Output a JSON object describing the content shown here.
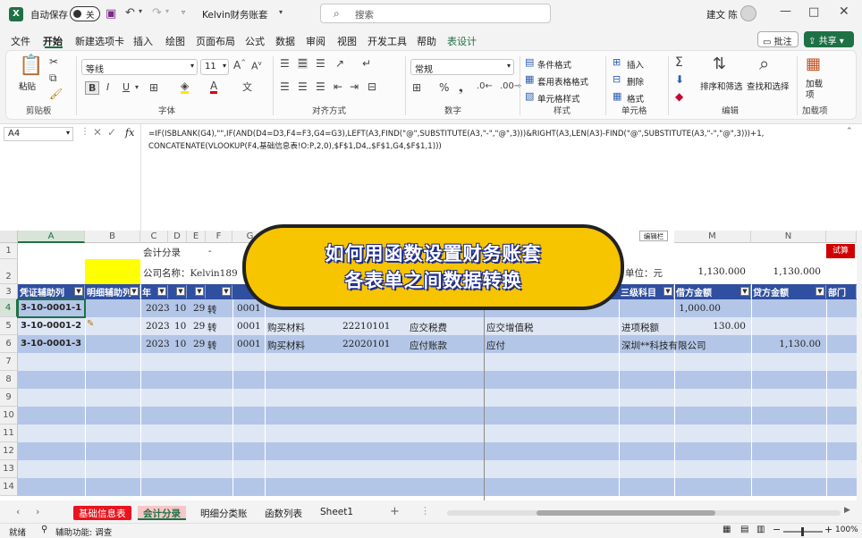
{
  "titlebar": {
    "autosave_label": "自动保存",
    "autosave_state": "关",
    "filename": "Kelvin财务账套",
    "search_placeholder": "搜索",
    "user": "建文 陈"
  },
  "menu": [
    "文件",
    "开始",
    "新建选项卡",
    "插入",
    "绘图",
    "页面布局",
    "公式",
    "数据",
    "审阅",
    "视图",
    "开发工具",
    "帮助",
    "表设计"
  ],
  "menu_active": "开始",
  "comments_button": "批注",
  "share_button": "共享",
  "ribbon": {
    "paste": "粘贴",
    "clipboard": "剪贴板",
    "font_name": "等线",
    "font_size": "11",
    "font_group": "字体",
    "align_group": "对齐方式",
    "number_format": "常规",
    "number_group": "数字",
    "cond_format": "条件格式",
    "table_format": "套用表格格式",
    "cell_style": "单元格样式",
    "style_group": "样式",
    "insert": "插入",
    "delete": "删除",
    "format": "格式",
    "cells_group": "单元格",
    "sort_filter": "排序和筛选",
    "find_select": "查找和选择",
    "edit_group": "编辑",
    "addin": "加载项",
    "addin_group": "加载项"
  },
  "formula_bar": {
    "name_box": "A4",
    "fx": "fx",
    "formula_line1": "=IF(ISBLANK(G4),\"\",IF(AND(D4=D3,F4=F3,G4=G3),LEFT(A3,FIND(\"@\",SUBSTITUTE(A3,\"-\",\"@\",3)))&RIGHT(A3,LEN(A3)-FIND(\"@\",SUBSTITUTE(A3,\"-\",\"@\",3)))+1,",
    "formula_line2": "CONCATENATE(VLOOKUP(F4,基础信息表!O:P,2,0),$F$1,D4,,$F$1,G4,$F$1,1)))"
  },
  "grid": {
    "columns": [
      "A",
      "B",
      "C",
      "D",
      "E",
      "F",
      "G",
      "M",
      "N"
    ],
    "row_numbers": [
      "1",
      "2",
      "3",
      "4",
      "5",
      "6",
      "7",
      "8",
      "9",
      "10",
      "11",
      "12",
      "13",
      "14"
    ],
    "row1_c": "会计分录",
    "row1_e": "-",
    "row2_c": "公司名称：Kelvin189",
    "row2_unit": "单位：元",
    "row2_m": "1,130.000",
    "row2_n": "1,130.000",
    "red_cell": "试算",
    "edit_tag": "编辑栏",
    "headers": {
      "a": "凭证辅助列",
      "b": "明细辅助列",
      "c": "年",
      "l": "三级科目",
      "m": "借方金额",
      "n": "贷方金额",
      "o": "部门"
    },
    "rows": [
      {
        "a": "3-10-0001-1",
        "c": "2023",
        "d": "10",
        "e": "29",
        "f": "转",
        "g": "0001",
        "h": "",
        "i": "",
        "j": "",
        "k": "",
        "l": "",
        "m": "1,000.00",
        "n": ""
      },
      {
        "a": "3-10-0001-2",
        "c": "2023",
        "d": "10",
        "e": "29",
        "f": "转",
        "g": "0001",
        "h": "购买材料",
        "i": "22210101",
        "j": "应交税费",
        "k": "应交增值税",
        "l": "进项税额",
        "m": "130.00",
        "n": ""
      },
      {
        "a": "3-10-0001-3",
        "c": "2023",
        "d": "10",
        "e": "29",
        "f": "转",
        "g": "0001",
        "h": "购买材料",
        "i": "22020101",
        "j": "应付账款",
        "k": "应付",
        "l": "深圳**科技有限公司",
        "m": "",
        "n": "1,130.00"
      }
    ]
  },
  "banner": {
    "line1": "如何用函数设置财务账套",
    "line2": "各表单之间数据转换"
  },
  "sheets": [
    "基础信息表",
    "会计分录",
    "明细分类账",
    "函数列表",
    "Sheet1"
  ],
  "active_sheet": "会计分录",
  "status": {
    "mode": "就绪",
    "accessibility": "辅助功能: 调查",
    "zoom": "100%"
  },
  "colors": {
    "excel_green": "#1e7145",
    "header_blue": "#2f4fa0",
    "row_band": "#b4c6e7",
    "banner_yellow": "#f7c400"
  }
}
